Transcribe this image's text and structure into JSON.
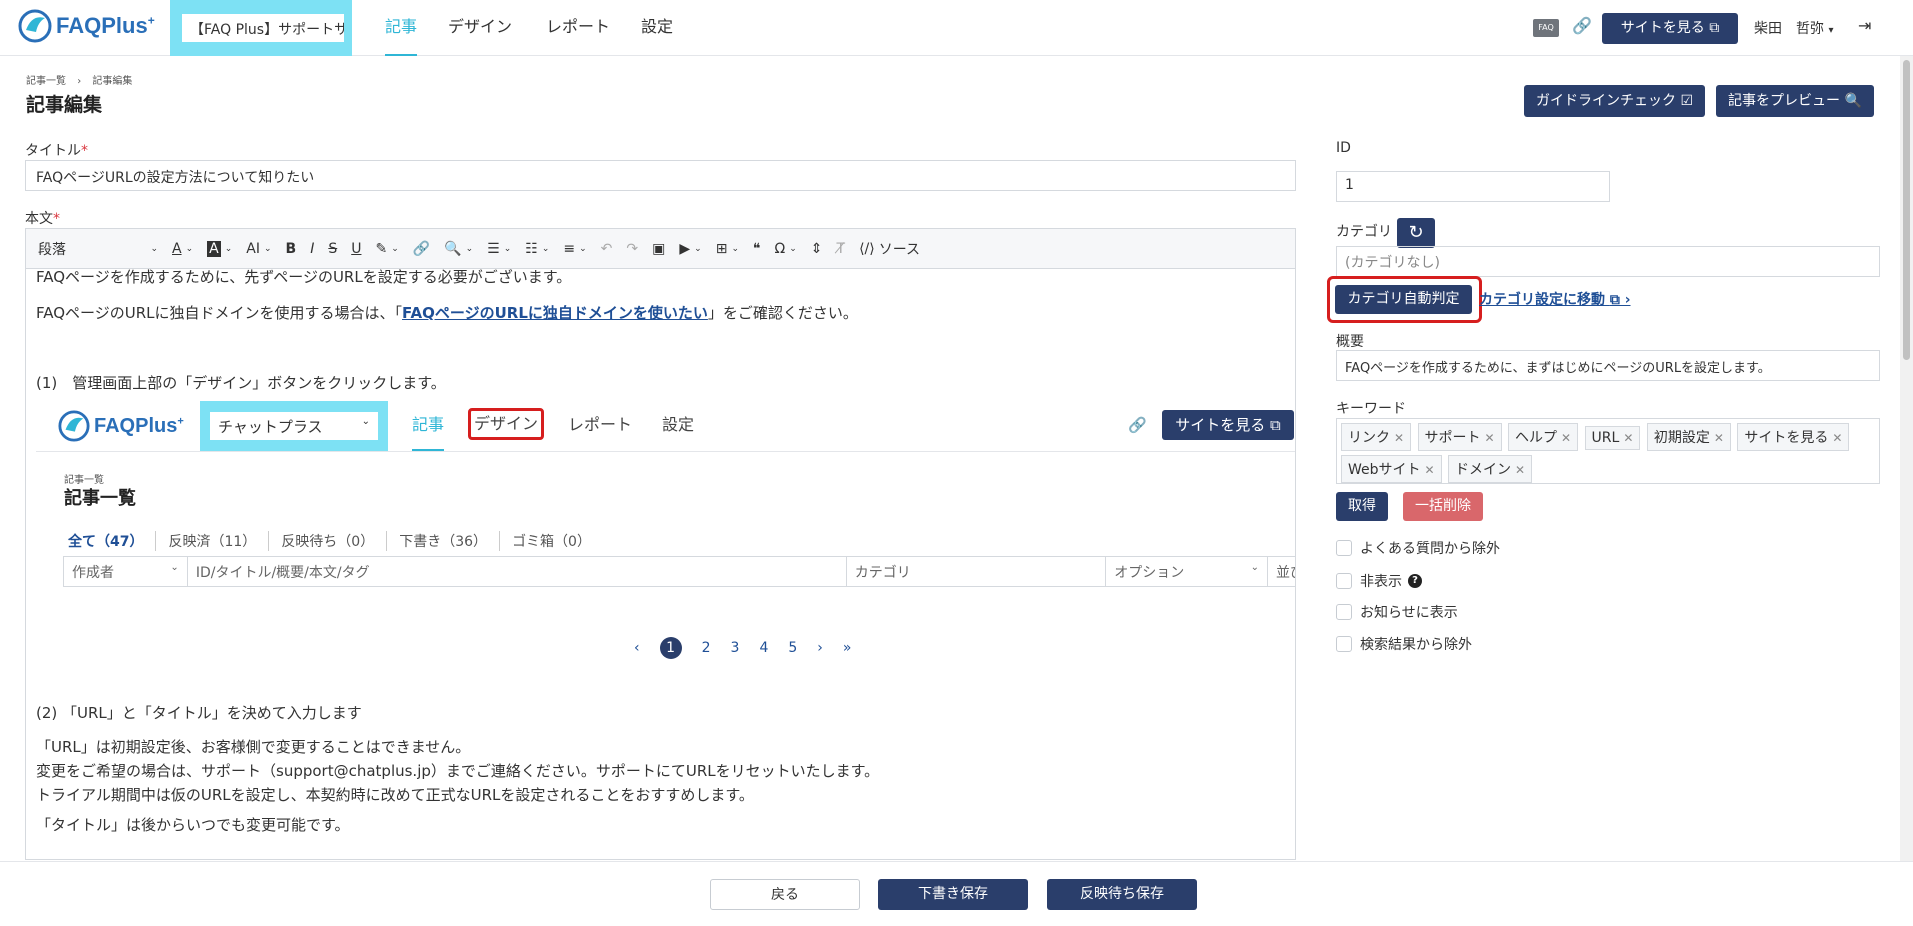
{
  "header": {
    "logo_text": "FAQPlus",
    "logo_plus": "+",
    "site_select": "【FAQ Plus】サポートサイト",
    "nav": [
      "記事",
      "デザイン",
      "レポート",
      "設定"
    ],
    "faq_badge": "FAQ",
    "view_site_label": "サイトを見る",
    "user_name": "柴田　哲弥",
    "accent_color": "#2fb6d6",
    "primary_color": "#2a3e6b"
  },
  "page": {
    "breadcrumb": [
      "記事一覧",
      "記事編集"
    ],
    "title": "記事編集",
    "guideline_button": "ガイドラインチェック",
    "preview_button": "記事をプレビュー"
  },
  "form": {
    "title_label": "タイトル",
    "title_value": "FAQページURLの設定方法について知りたい",
    "body_label": "本文",
    "required_mark": "*"
  },
  "toolbar": {
    "paragraph": "段落",
    "source": "ソース"
  },
  "body": {
    "p1": "FAQページを作成するために、先ずページのURLを設定する必要がございます。",
    "p2_before": "FAQページのURLに独自ドメインを使用する場合は、「",
    "p2_link": "FAQページのURLに独自ドメインを使いたい",
    "p2_after": "」をご確認ください。",
    "step1": "(1)　管理画面上部の「デザイン」ボタンをクリックします。",
    "step2": "(2) 「URL」と「タイトル」を決めて入力します",
    "p3": "「URL」は初期設定後、お客様側で変更することはできません。",
    "p4": "変更をご希望の場合は、サポート（support@chatplus.jp）までご連絡ください。サポートにてURLをリセットいたします。",
    "p5": "トライアル期間中は仮のURLを設定し、本契約時に改めて正式なURLを設定されることをおすすめします。",
    "p6": "「タイトル」は後からいつでも変更可能です。"
  },
  "embedded": {
    "logo_text": "FAQPlus",
    "logo_plus": "+",
    "select_value": "チャットプラス",
    "nav": [
      "記事",
      "デザイン",
      "レポート",
      "設定"
    ],
    "site_button": "サイトを見る",
    "breadcrumb": "記事一覧",
    "title": "記事一覧",
    "tabs": [
      "全て（47）",
      "反映済（11）",
      "反映待ち（0）",
      "下書き（36）",
      "ゴミ箱（0）"
    ],
    "filter": [
      "作成者",
      "ID/タイトル/概要/本文/タグ",
      "カテゴリ",
      "オプション",
      "並び"
    ],
    "pagination": [
      "‹",
      "1",
      "2",
      "3",
      "4",
      "5",
      "›",
      "»"
    ]
  },
  "sidebar": {
    "id_label": "ID",
    "id_value": "1",
    "category_label": "カテゴリ",
    "category_placeholder": "(カテゴリなし)",
    "auto_category_button": "カテゴリ自動判定",
    "category_settings_link": "カテゴリ設定に移動",
    "summary_label": "概要",
    "summary_value": "FAQページを作成するために、まずはじめにページのURLを設定します。",
    "keyword_label": "キーワード",
    "keywords": [
      "リンク",
      "サポート",
      "ヘルプ",
      "URL",
      "初期設定",
      "サイトを見る",
      "Webサイト",
      "ドメイン"
    ],
    "fetch_button": "取得",
    "bulk_delete_button": "一括削除",
    "checkboxes": [
      "よくある質問から除外",
      "非表示",
      "お知らせに表示",
      "検索結果から除外"
    ],
    "danger_color": "#d9676b"
  },
  "footer": {
    "back": "戻る",
    "save_draft": "下書き保存",
    "save_pending": "反映待ち保存"
  }
}
